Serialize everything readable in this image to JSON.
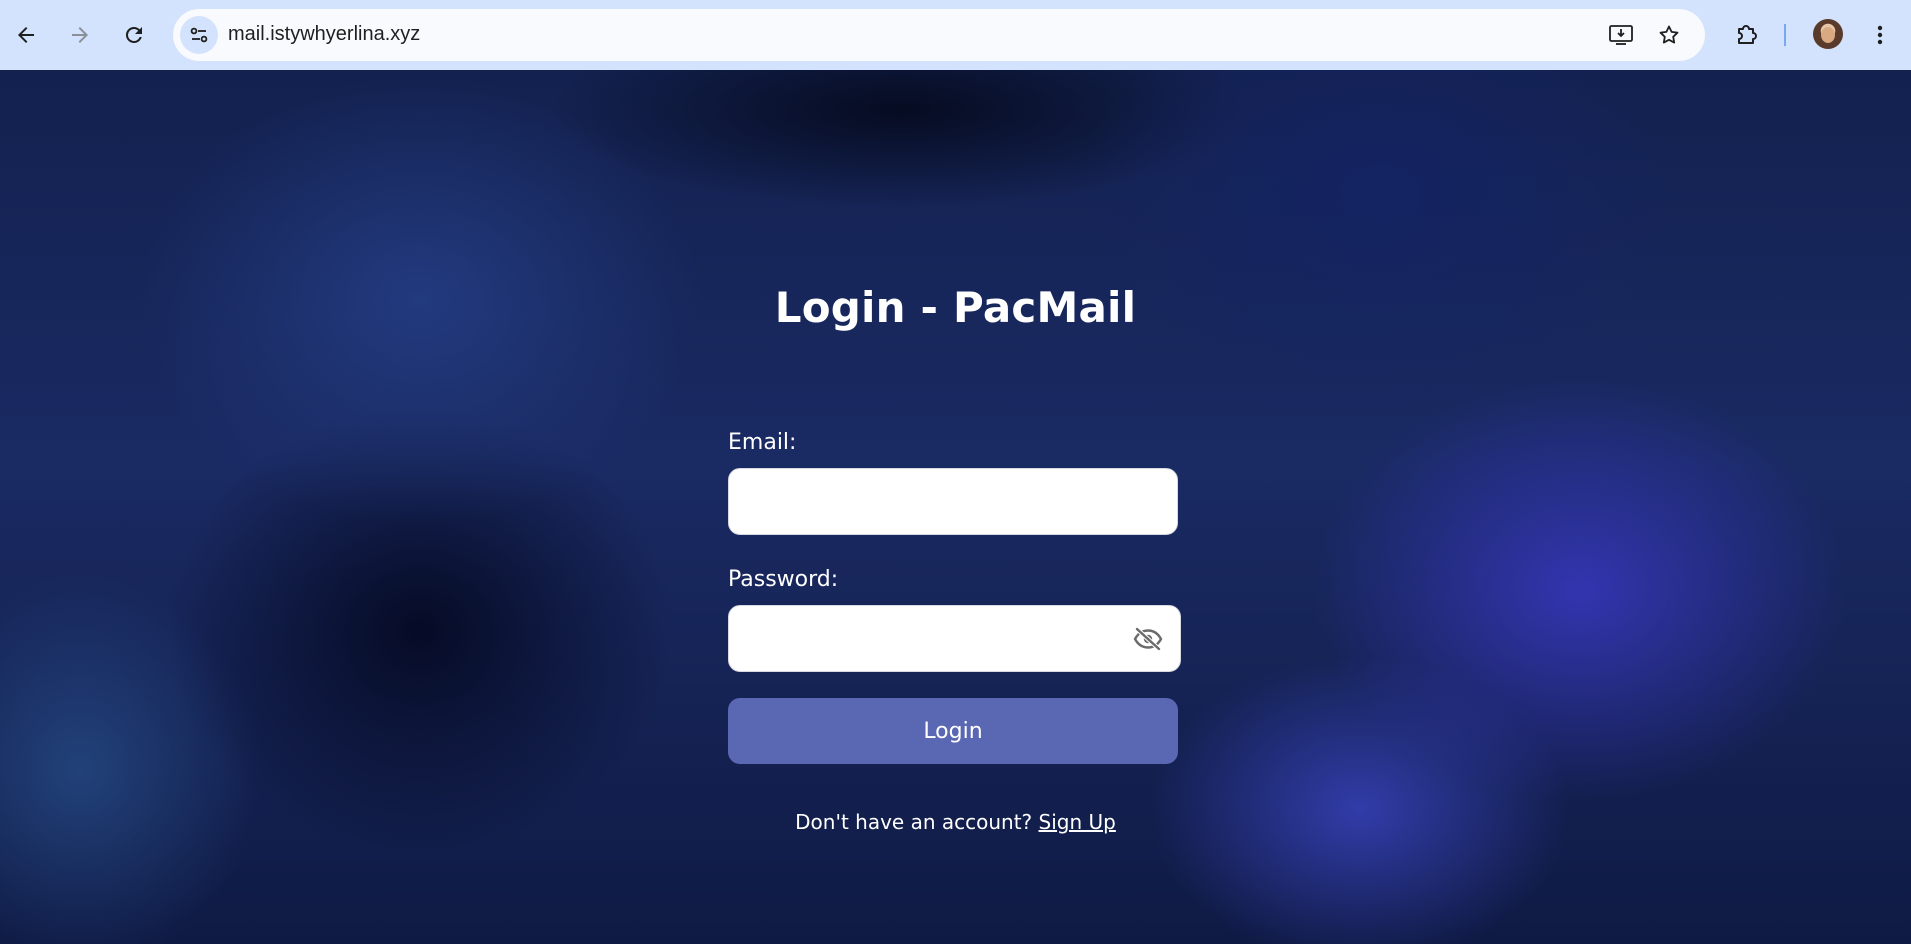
{
  "browser": {
    "url": "mail.istywhyerlina.xyz",
    "icons": {
      "back": "arrow-left-icon",
      "forward": "arrow-right-icon",
      "reload": "reload-icon",
      "site_info": "tune-icon",
      "install": "install-app-icon",
      "bookmark": "star-icon",
      "extensions": "puzzle-icon",
      "menu": "more-vertical-icon"
    },
    "colors": {
      "chrome_bg": "#d3e3fd",
      "omnibox_bg": "#f8fafd"
    }
  },
  "page": {
    "title": "Login - PacMail",
    "email_label": "Email:",
    "email_value": "",
    "password_label": "Password:",
    "password_value": "",
    "password_toggle_icon": "eye-off-icon",
    "login_button": "Login",
    "signup_prompt": "Don't have an account?",
    "signup_link": "Sign Up",
    "colors": {
      "button_bg": "#5a67b3",
      "text": "#ffffff"
    }
  }
}
